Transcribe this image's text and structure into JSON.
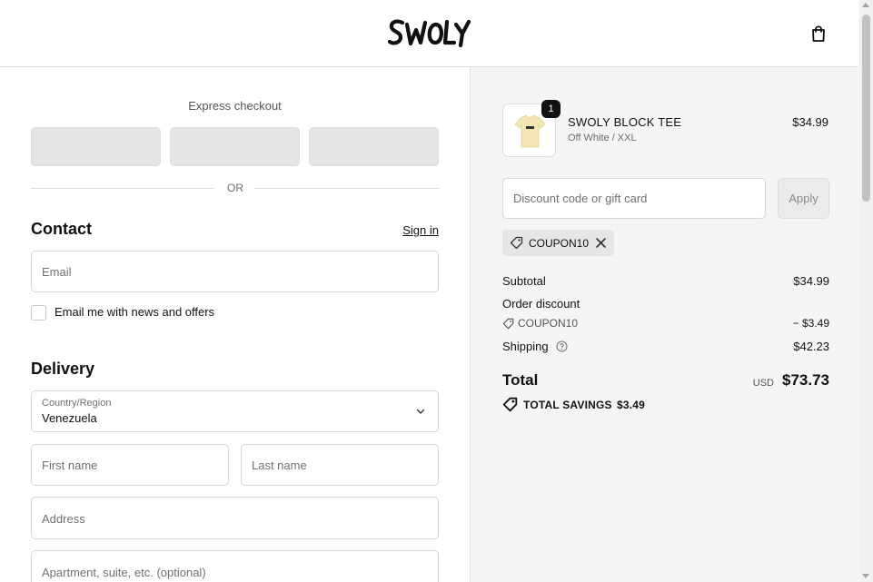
{
  "header": {
    "logo_text": "SWOLY",
    "cart_icon": "shopping-bag-icon"
  },
  "express": {
    "title": "Express checkout",
    "or_label": "OR"
  },
  "contact": {
    "title": "Contact",
    "signin_label": "Sign in",
    "email_placeholder": "Email",
    "newsletter_label": "Email me with news and offers"
  },
  "delivery": {
    "title": "Delivery",
    "country_label": "Country/Region",
    "country_value": "Venezuela",
    "first_name_placeholder": "First name",
    "last_name_placeholder": "Last name",
    "address_placeholder": "Address",
    "apartment_placeholder": "Apartment, suite, etc. (optional)"
  },
  "order": {
    "item": {
      "quantity": "1",
      "name": "SWOLY BLOCK TEE",
      "variant": "Off White / XXL",
      "price": "$34.99",
      "thumb_color": "#f3e6b4"
    },
    "discount_placeholder": "Discount code or gift card",
    "apply_label": "Apply",
    "coupon_code": "COUPON10",
    "subtotal_label": "Subtotal",
    "subtotal_value": "$34.99",
    "order_discount_label": "Order discount",
    "discount_code": "COUPON10",
    "discount_value": "− $3.49",
    "shipping_label": "Shipping",
    "shipping_value": "$42.23",
    "total_label": "Total",
    "currency": "USD",
    "total_value": "$73.73",
    "savings_label": "TOTAL SAVINGS",
    "savings_value": "$3.49"
  }
}
